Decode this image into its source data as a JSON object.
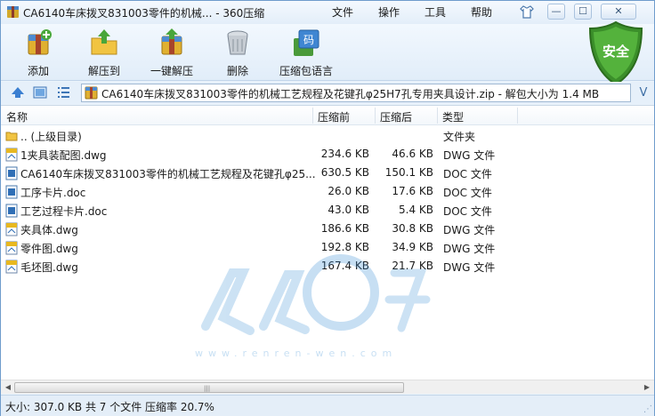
{
  "window": {
    "title": "CA6140车床拨叉831003零件的机械... - 360压缩",
    "menu": [
      "文件",
      "操作",
      "工具",
      "帮助"
    ],
    "controls": {
      "minimize": "—",
      "maximize": "☐",
      "close": "✕"
    }
  },
  "toolbar": {
    "items": [
      {
        "label": "添加",
        "icon": "add-archive-icon"
      },
      {
        "label": "解压到",
        "icon": "extract-to-icon"
      },
      {
        "label": "一键解压",
        "icon": "one-click-extract-icon"
      },
      {
        "label": "删除",
        "icon": "trash-icon"
      },
      {
        "label": "压缩包语言",
        "icon": "archive-language-icon",
        "glyph": "码"
      }
    ],
    "security_badge": "安全"
  },
  "address": {
    "text": "CA6140车床拨叉831003零件的机械工艺规程及花键孔φ25H7孔专用夹具设计.zip - 解包大小为 1.4 MB",
    "dropdown": "V"
  },
  "list": {
    "headers": {
      "name": "名称",
      "compressed": "压缩前",
      "packed": "压缩后",
      "type": "类型"
    },
    "rows": [
      {
        "name": ".. (上级目录)",
        "before": "",
        "after": "",
        "type": "文件夹",
        "icon": "folder"
      },
      {
        "name": "1夹具装配图.dwg",
        "before": "234.6 KB",
        "after": "46.6 KB",
        "type": "DWG 文件",
        "icon": "dwg"
      },
      {
        "name": "CA6140车床拨叉831003零件的机械工艺规程及花键孔φ25...",
        "before": "630.5 KB",
        "after": "150.1 KB",
        "type": "DOC 文件",
        "icon": "doc"
      },
      {
        "name": "工序卡片.doc",
        "before": "26.0 KB",
        "after": "17.6 KB",
        "type": "DOC 文件",
        "icon": "doc"
      },
      {
        "name": "工艺过程卡片.doc",
        "before": "43.0 KB",
        "after": "5.4 KB",
        "type": "DOC 文件",
        "icon": "doc"
      },
      {
        "name": "夹具体.dwg",
        "before": "186.6 KB",
        "after": "30.8 KB",
        "type": "DWG 文件",
        "icon": "dwg"
      },
      {
        "name": "零件图.dwg",
        "before": "192.8 KB",
        "after": "34.9 KB",
        "type": "DWG 文件",
        "icon": "dwg"
      },
      {
        "name": "毛坯图.dwg",
        "before": "167.4 KB",
        "after": "21.7 KB",
        "type": "DWG 文件",
        "icon": "dwg"
      }
    ]
  },
  "watermark": {
    "text": "www.renren-wen.com"
  },
  "status": {
    "text": "大小: 307.0 KB 共 7 个文件 压缩率 20.7%"
  },
  "colors": {
    "accent": "#2f6fb6",
    "safe_green": "#3f9a2c",
    "list_bg": "#ffffff",
    "chrome": "#e6f0fa"
  }
}
